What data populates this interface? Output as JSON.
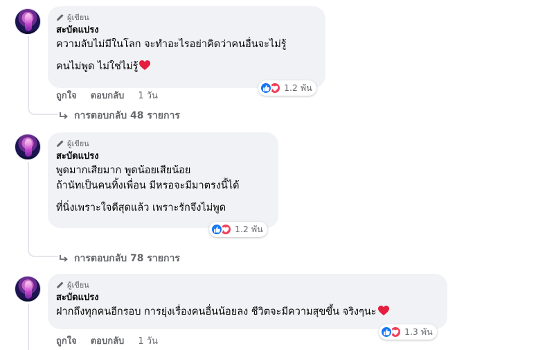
{
  "colors": {
    "like_blue": "#1877f2",
    "love_red": "#f33e58",
    "bubble_bg": "#f0f2f5",
    "muted_text": "#65676b"
  },
  "icons": {
    "author_badge": "pencil-icon",
    "replies": "reply-arrow-icon",
    "reaction_like": "thumbs-up-icon",
    "reaction_love": "heart-icon"
  },
  "comments": [
    {
      "badge": "ผู้เขียน",
      "name": "สะบัดแปรง",
      "lines": [
        "ความลับไม่มีในโลก จะทำอะไรอย่าคิดว่าคนอื่นจะไม่รู้",
        "คนไม่พูด ไม่ใช่ไม่รู้"
      ],
      "reactions": "1.2 พัน",
      "like": "ถูกใจ",
      "reply": "ตอบกลับ",
      "time": "1 วัน",
      "replies": "การตอบกลับ 48 รายการ"
    },
    {
      "badge": "ผู้เขียน",
      "name": "สะบัดแปรง",
      "lines": [
        "พูดมากเสียมาก พูดน้อยเสียน้อย",
        "ถ้านัทเป็นคนทิ้งเพื่อน มีหรอจะมีมาตรงนี้ได้",
        "ที่นิ่งเพราะใจดีสุดแล้ว เพราะรักจึงไม่พูด"
      ],
      "reactions": "1.2 พัน",
      "replies": "การตอบกลับ 78 รายการ"
    },
    {
      "badge": "ผู้เขียน",
      "name": "สะบัดแปรง",
      "lines": [
        "ฝากถึงทุกคนอีกรอบ การยุ่งเรื่องคนอื่นน้อยลง ชีวิตจะมีความสุขขึ้น จริงๆนะ"
      ],
      "reactions": "1.3 พัน",
      "like": "ถูกใจ",
      "reply": "ตอบกลับ",
      "time": "1 วัน"
    }
  ]
}
